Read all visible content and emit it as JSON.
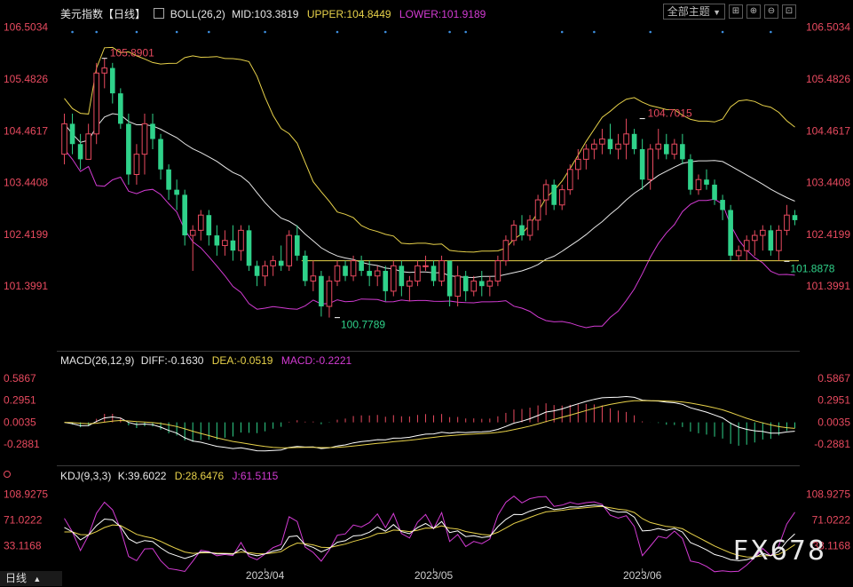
{
  "header": {
    "title": "美元指数【日线】",
    "indicator": "BOLL(26,2)",
    "mid": "MID:103.3819",
    "upper": "UPPER:104.8449",
    "lower": "LOWER:101.9189",
    "theme_label": "全部主题",
    "theme_arrow": "▼"
  },
  "macd_header": {
    "name": "MACD(26,12,9)",
    "diff": "DIFF:-0.1630",
    "dea": "DEA:-0.0519",
    "macd": "MACD:-0.2221"
  },
  "kdj_header": {
    "name": "KDJ(9,3,3)",
    "k": "K:39.6022",
    "d": "D:28.6476",
    "j": "J:61.5115"
  },
  "bottom_bar": {
    "label": "日线",
    "arrow": "▲"
  },
  "watermark": "FX678",
  "colors": {
    "up": "#e84a5f",
    "down": "#2fd28a",
    "upper": "#e8d24a",
    "mid": "#e6e6e6",
    "lower": "#d33bd3",
    "diff": "#ffffff",
    "dea": "#e8d24a",
    "k": "#ffffff",
    "d": "#e8d24a",
    "j": "#d33bd3"
  },
  "chart_data": [
    {
      "type": "candlestick",
      "ylim": [
        100.3,
        106.55
      ],
      "yticks": [
        "106.5034",
        "105.4826",
        "104.4617",
        "103.4408",
        "102.4199",
        "101.3991"
      ],
      "xticks": [
        "2023/04",
        "2023/05",
        "2023/06"
      ],
      "xtick_index": [
        25,
        46,
        72
      ],
      "annotations": [
        {
          "text": "105.8901",
          "index": 5,
          "value": 105.8901,
          "color": "up"
        },
        {
          "text": "100.7789",
          "index": 34,
          "value": 100.7789,
          "color": "down"
        },
        {
          "text": "104.7015",
          "index": 72,
          "value": 104.7015,
          "color": "up"
        },
        {
          "text": "101.8878",
          "index": 90,
          "value": 101.8878,
          "color": "down"
        }
      ],
      "hline": 101.9,
      "ohlc": [
        [
          104.0,
          104.8,
          103.8,
          104.6
        ],
        [
          104.6,
          104.8,
          104.0,
          104.2
        ],
        [
          104.2,
          104.4,
          103.7,
          103.9
        ],
        [
          103.9,
          104.6,
          103.9,
          104.4
        ],
        [
          104.4,
          105.8,
          104.2,
          105.6
        ],
        [
          105.6,
          105.89,
          105.3,
          105.7
        ],
        [
          105.7,
          105.8,
          105.0,
          105.2
        ],
        [
          105.2,
          105.3,
          104.5,
          104.6
        ],
        [
          104.6,
          104.8,
          103.4,
          103.6
        ],
        [
          103.6,
          104.2,
          103.4,
          104.0
        ],
        [
          104.0,
          104.8,
          103.6,
          104.6
        ],
        [
          104.6,
          104.8,
          104.1,
          104.3
        ],
        [
          104.3,
          104.4,
          103.5,
          103.7
        ],
        [
          103.7,
          103.8,
          103.1,
          103.3
        ],
        [
          103.3,
          103.5,
          102.9,
          103.2
        ],
        [
          103.2,
          103.3,
          102.2,
          102.4
        ],
        [
          102.4,
          102.6,
          101.7,
          102.5
        ],
        [
          102.5,
          102.9,
          102.3,
          102.8
        ],
        [
          102.8,
          102.9,
          102.2,
          102.4
        ],
        [
          102.4,
          102.6,
          102.0,
          102.2
        ],
        [
          102.2,
          102.5,
          102.0,
          102.3
        ],
        [
          102.3,
          102.6,
          101.9,
          102.1
        ],
        [
          102.1,
          102.6,
          101.9,
          102.5
        ],
        [
          102.5,
          102.6,
          101.7,
          101.8
        ],
        [
          101.8,
          101.9,
          101.4,
          101.6
        ],
        [
          101.6,
          101.9,
          101.4,
          101.8
        ],
        [
          101.8,
          102.0,
          101.6,
          101.9
        ],
        [
          101.9,
          102.2,
          101.7,
          101.8
        ],
        [
          101.8,
          102.5,
          101.7,
          102.4
        ],
        [
          102.4,
          102.6,
          101.9,
          102.0
        ],
        [
          102.0,
          102.1,
          101.4,
          101.5
        ],
        [
          101.5,
          101.9,
          101.3,
          101.6
        ],
        [
          101.6,
          101.7,
          100.8,
          101.0
        ],
        [
          101.0,
          101.6,
          100.78,
          101.5
        ],
        [
          101.5,
          101.9,
          101.4,
          101.8
        ],
        [
          101.8,
          101.9,
          101.5,
          101.6
        ],
        [
          101.6,
          102.0,
          101.5,
          101.9
        ],
        [
          101.9,
          102.0,
          101.6,
          101.7
        ],
        [
          101.7,
          101.9,
          101.4,
          101.6
        ],
        [
          101.6,
          101.8,
          101.4,
          101.7
        ],
        [
          101.7,
          101.8,
          101.1,
          101.3
        ],
        [
          101.3,
          101.9,
          101.2,
          101.8
        ],
        [
          101.8,
          101.9,
          101.2,
          101.4
        ],
        [
          101.4,
          101.6,
          101.1,
          101.5
        ],
        [
          101.5,
          101.9,
          101.4,
          101.8
        ],
        [
          101.8,
          102.0,
          101.7,
          101.8
        ],
        [
          101.8,
          101.9,
          101.4,
          101.5
        ],
        [
          101.5,
          102.0,
          101.4,
          101.9
        ],
        [
          101.9,
          101.9,
          101.0,
          101.2
        ],
        [
          101.2,
          101.8,
          101.0,
          101.6
        ],
        [
          101.6,
          101.7,
          101.1,
          101.3
        ],
        [
          101.3,
          101.6,
          101.2,
          101.5
        ],
        [
          101.5,
          101.7,
          101.2,
          101.4
        ],
        [
          101.4,
          101.6,
          101.2,
          101.5
        ],
        [
          101.5,
          102.0,
          101.4,
          101.9
        ],
        [
          101.9,
          102.4,
          101.8,
          102.3
        ],
        [
          102.3,
          102.7,
          102.2,
          102.6
        ],
        [
          102.6,
          102.8,
          102.3,
          102.4
        ],
        [
          102.4,
          102.8,
          102.3,
          102.7
        ],
        [
          102.7,
          103.2,
          102.5,
          103.1
        ],
        [
          103.1,
          103.5,
          102.8,
          103.4
        ],
        [
          103.4,
          103.5,
          102.9,
          103.0
        ],
        [
          103.0,
          103.4,
          102.9,
          103.3
        ],
        [
          103.3,
          103.8,
          103.2,
          103.7
        ],
        [
          103.7,
          104.1,
          103.5,
          103.9
        ],
        [
          103.9,
          104.2,
          103.7,
          104.1
        ],
        [
          104.1,
          104.3,
          103.9,
          104.2
        ],
        [
          104.2,
          104.5,
          104.0,
          104.3
        ],
        [
          104.3,
          104.6,
          104.0,
          104.1
        ],
        [
          104.1,
          104.4,
          103.9,
          104.2
        ],
        [
          104.2,
          104.7,
          103.9,
          104.4
        ],
        [
          104.4,
          104.5,
          104.0,
          104.1
        ],
        [
          104.1,
          104.3,
          103.3,
          103.5
        ],
        [
          103.5,
          104.2,
          103.3,
          104.1
        ],
        [
          104.1,
          104.5,
          103.9,
          104.2
        ],
        [
          104.2,
          104.4,
          103.9,
          104.0
        ],
        [
          104.0,
          104.3,
          103.9,
          104.2
        ],
        [
          104.2,
          104.4,
          103.8,
          103.9
        ],
        [
          103.9,
          104.0,
          103.2,
          103.3
        ],
        [
          103.3,
          103.6,
          103.2,
          103.5
        ],
        [
          103.5,
          103.7,
          103.3,
          103.4
        ],
        [
          103.4,
          103.5,
          103.0,
          103.1
        ],
        [
          103.1,
          103.2,
          102.7,
          102.9
        ],
        [
          102.9,
          103.0,
          101.9,
          102.0
        ],
        [
          102.0,
          102.2,
          101.9,
          102.1
        ],
        [
          102.1,
          102.4,
          101.9,
          102.3
        ],
        [
          102.3,
          102.5,
          102.0,
          102.4
        ],
        [
          102.4,
          102.6,
          102.1,
          102.5
        ],
        [
          102.5,
          102.6,
          102.0,
          102.1
        ],
        [
          102.1,
          102.6,
          101.9,
          102.5
        ],
        [
          102.5,
          103.0,
          102.4,
          102.8
        ],
        [
          102.8,
          102.9,
          102.6,
          102.7
        ]
      ]
    },
    {
      "type": "bar",
      "name": "MACD",
      "ylim": [
        -0.5,
        0.75
      ],
      "yticks": [
        "0.5867",
        "0.2951",
        "0.0035",
        "-0.2881"
      ]
    },
    {
      "type": "line",
      "name": "KDJ",
      "ylim": [
        0,
        125
      ],
      "yticks": [
        "108.9275",
        "71.0222",
        "33.1168"
      ]
    }
  ]
}
